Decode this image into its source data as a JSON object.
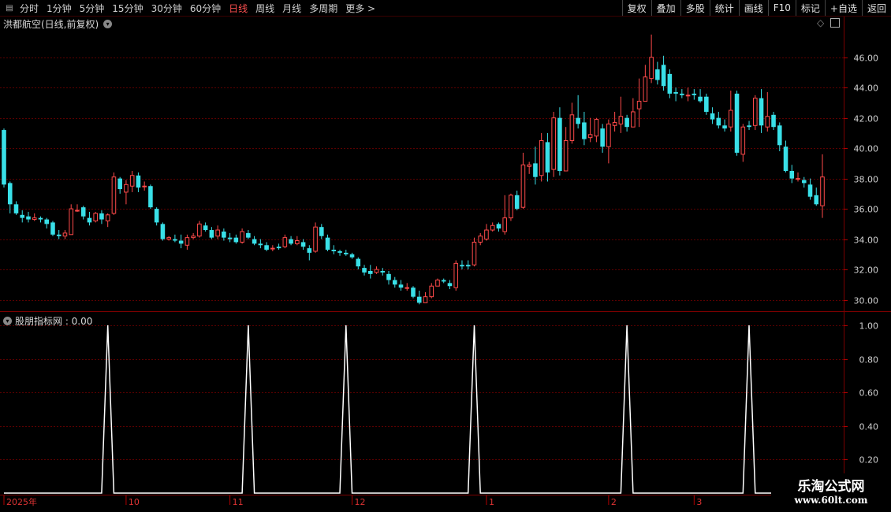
{
  "toolbar": {
    "periods": [
      {
        "label": "分时",
        "active": false
      },
      {
        "label": "1分钟",
        "active": false
      },
      {
        "label": "5分钟",
        "active": false
      },
      {
        "label": "15分钟",
        "active": false
      },
      {
        "label": "30分钟",
        "active": false
      },
      {
        "label": "60分钟",
        "active": false
      },
      {
        "label": "日线",
        "active": true
      },
      {
        "label": "周线",
        "active": false
      },
      {
        "label": "月线",
        "active": false
      },
      {
        "label": "多周期",
        "active": false
      },
      {
        "label": "更多 >",
        "active": false
      }
    ],
    "buttons": [
      "复权",
      "叠加",
      "多股",
      "统计",
      "画线",
      "F10",
      "标记",
      "+自选",
      "返回"
    ]
  },
  "main_panel": {
    "title": "洪都航空(日线,前复权)"
  },
  "indicator_panel": {
    "title": "股朋指标网 : 0.00"
  },
  "watermark": {
    "line1": "乐淘公式网",
    "line2": "www.60lt.com"
  },
  "colors": {
    "up": "#ff4a4a",
    "down": "#39e0e8",
    "grid": "#5a0000",
    "axis_text": "#d0d0d0",
    "background": "#000000",
    "line": "#ffffff"
  },
  "chart_data": [
    {
      "type": "candlestick",
      "title": "洪都航空(日线,前复权)",
      "y_axis": {
        "ticks": [
          30.0,
          32.0,
          34.0,
          36.0,
          38.0,
          40.0,
          42.0,
          44.0,
          46.0
        ],
        "ylim": [
          29.3,
          47.7
        ]
      },
      "x_axis": {
        "labels": [
          {
            "text": "2025年",
            "index": 0
          },
          {
            "text": "10",
            "index": 20
          },
          {
            "text": "11",
            "index": 37
          },
          {
            "text": "12",
            "index": 57
          },
          {
            "text": "1",
            "index": 79
          },
          {
            "text": "2",
            "index": 99
          },
          {
            "text": "3",
            "index": 113
          }
        ]
      },
      "candles": [
        [
          41.2,
          37.6,
          41.3,
          37.4
        ],
        [
          37.7,
          36.3,
          37.8,
          35.7
        ],
        [
          36.3,
          35.7,
          36.5,
          35.6
        ],
        [
          35.6,
          35.4,
          35.9,
          35.1
        ],
        [
          35.5,
          35.3,
          35.8,
          35.1
        ],
        [
          35.3,
          35.4,
          35.7,
          35.2
        ],
        [
          35.4,
          35.3,
          35.5,
          35.1
        ],
        [
          35.3,
          35.0,
          35.4,
          34.7
        ],
        [
          35.1,
          34.3,
          35.2,
          34.2
        ],
        [
          34.3,
          34.2,
          34.6,
          34.0
        ],
        [
          34.2,
          34.4,
          34.6,
          34.0
        ],
        [
          34.3,
          36.0,
          36.3,
          34.3
        ],
        [
          35.9,
          35.9,
          36.3,
          35.8
        ],
        [
          36.1,
          35.5,
          36.2,
          35.3
        ],
        [
          35.4,
          35.1,
          35.8,
          34.9
        ],
        [
          35.2,
          35.7,
          35.8,
          35.1
        ],
        [
          35.7,
          35.3,
          35.9,
          35.0
        ],
        [
          35.2,
          35.6,
          35.7,
          34.8
        ],
        [
          35.7,
          38.1,
          38.4,
          35.6
        ],
        [
          38.0,
          37.3,
          38.1,
          37.0
        ],
        [
          37.1,
          37.6,
          37.9,
          36.3
        ],
        [
          37.5,
          38.2,
          38.5,
          37.1
        ],
        [
          38.2,
          37.4,
          38.4,
          37.1
        ],
        [
          37.5,
          37.5,
          37.8,
          37.2
        ],
        [
          37.5,
          36.1,
          37.6,
          36.0
        ],
        [
          36.0,
          35.1,
          36.1,
          34.9
        ],
        [
          35.0,
          34.0,
          35.1,
          33.9
        ],
        [
          34.0,
          34.1,
          34.2,
          33.9
        ],
        [
          34.0,
          33.9,
          34.3,
          33.8
        ],
        [
          33.9,
          33.7,
          34.3,
          33.4
        ],
        [
          33.6,
          34.1,
          34.3,
          33.3
        ],
        [
          34.1,
          34.2,
          34.4,
          34.0
        ],
        [
          34.2,
          35.0,
          35.2,
          34.1
        ],
        [
          34.9,
          34.6,
          35.1,
          34.5
        ],
        [
          34.6,
          34.1,
          34.8,
          34.0
        ],
        [
          34.2,
          34.6,
          34.9,
          34.0
        ],
        [
          34.5,
          34.1,
          34.7,
          33.9
        ],
        [
          34.1,
          34.0,
          34.4,
          33.8
        ],
        [
          34.1,
          33.8,
          34.3,
          33.7
        ],
        [
          33.8,
          34.5,
          34.7,
          33.7
        ],
        [
          34.4,
          34.1,
          34.6,
          34.0
        ],
        [
          34.0,
          33.7,
          34.2,
          33.6
        ],
        [
          33.7,
          33.6,
          34.0,
          33.4
        ],
        [
          33.6,
          33.3,
          33.8,
          33.2
        ],
        [
          33.4,
          33.4,
          33.6,
          33.2
        ],
        [
          33.5,
          33.4,
          33.7,
          33.3
        ],
        [
          33.5,
          34.1,
          34.3,
          33.4
        ],
        [
          34.0,
          33.7,
          34.2,
          33.6
        ],
        [
          33.7,
          33.9,
          34.2,
          33.6
        ],
        [
          33.8,
          33.5,
          34.0,
          33.3
        ],
        [
          33.4,
          33.1,
          33.6,
          32.6
        ],
        [
          33.2,
          34.8,
          35.1,
          33.1
        ],
        [
          34.8,
          34.2,
          35.0,
          34.0
        ],
        [
          34.1,
          33.3,
          34.3,
          33.2
        ],
        [
          33.3,
          33.2,
          33.6,
          33.0
        ],
        [
          33.2,
          33.1,
          33.3,
          32.9
        ],
        [
          33.1,
          33.0,
          33.3,
          32.9
        ],
        [
          33.0,
          32.8,
          33.1,
          32.7
        ],
        [
          32.7,
          32.2,
          32.8,
          32.0
        ],
        [
          32.1,
          31.8,
          32.3,
          31.6
        ],
        [
          31.9,
          31.7,
          32.3,
          31.4
        ],
        [
          31.8,
          32.0,
          32.2,
          31.7
        ],
        [
          31.9,
          31.8,
          32.1,
          31.6
        ],
        [
          31.7,
          31.3,
          31.9,
          31.0
        ],
        [
          31.3,
          31.0,
          31.5,
          30.8
        ],
        [
          31.0,
          30.8,
          31.3,
          30.6
        ],
        [
          30.8,
          30.8,
          31.1,
          30.6
        ],
        [
          30.8,
          30.2,
          30.9,
          30.1
        ],
        [
          30.2,
          29.8,
          30.6,
          29.7
        ],
        [
          29.8,
          30.2,
          30.5,
          29.8
        ],
        [
          30.2,
          30.9,
          31.1,
          30.1
        ],
        [
          30.9,
          31.3,
          31.4,
          30.9
        ],
        [
          31.3,
          31.2,
          31.4,
          31.1
        ],
        [
          31.1,
          30.9,
          31.3,
          30.7
        ],
        [
          30.8,
          32.4,
          32.6,
          30.6
        ],
        [
          32.3,
          32.2,
          32.6,
          32.0
        ],
        [
          32.3,
          32.2,
          32.6,
          32.0
        ],
        [
          32.3,
          33.8,
          34.1,
          32.2
        ],
        [
          33.8,
          34.2,
          34.4,
          33.6
        ],
        [
          34.0,
          34.6,
          35.0,
          33.9
        ],
        [
          34.6,
          34.9,
          35.1,
          34.5
        ],
        [
          35.0,
          34.7,
          35.1,
          34.5
        ],
        [
          34.5,
          35.4,
          36.9,
          34.3
        ],
        [
          35.4,
          36.9,
          37.0,
          35.2
        ],
        [
          36.9,
          36.0,
          37.2,
          35.9
        ],
        [
          36.1,
          38.9,
          39.7,
          36.0
        ],
        [
          38.8,
          38.9,
          39.1,
          38.3
        ],
        [
          39.0,
          38.1,
          40.1,
          37.6
        ],
        [
          38.2,
          40.5,
          41.0,
          37.8
        ],
        [
          40.4,
          38.4,
          41.0,
          37.8
        ],
        [
          38.6,
          42.0,
          42.4,
          38.1
        ],
        [
          42.0,
          38.5,
          42.7,
          38.2
        ],
        [
          38.5,
          40.5,
          41.4,
          38.9
        ],
        [
          40.5,
          42.2,
          43.0,
          40.3
        ],
        [
          42.0,
          41.6,
          43.5,
          41.3
        ],
        [
          41.7,
          40.6,
          42.4,
          40.2
        ],
        [
          40.7,
          40.9,
          42.0,
          40.4
        ],
        [
          40.8,
          41.9,
          42.0,
          40.4
        ],
        [
          41.3,
          40.1,
          41.6,
          39.7
        ],
        [
          40.1,
          41.6,
          41.9,
          39.0
        ],
        [
          41.5,
          41.7,
          42.4,
          41.1
        ],
        [
          41.6,
          42.1,
          43.4,
          41.0
        ],
        [
          42.0,
          41.4,
          42.2,
          41.1
        ],
        [
          41.4,
          42.4,
          43.3,
          41.5
        ],
        [
          42.6,
          43.1,
          44.6,
          41.4
        ],
        [
          43.1,
          44.7,
          45.5,
          43.1
        ],
        [
          44.6,
          46.0,
          47.5,
          44.3
        ],
        [
          45.2,
          44.5,
          45.7,
          44.2
        ],
        [
          45.5,
          44.1,
          46.1,
          43.8
        ],
        [
          44.9,
          43.6,
          45.2,
          43.3
        ],
        [
          43.7,
          43.6,
          44.0,
          43.1
        ],
        [
          43.6,
          43.5,
          43.9,
          43.3
        ],
        [
          43.5,
          43.5,
          44.0,
          43.1
        ],
        [
          43.6,
          43.5,
          43.9,
          43.2
        ],
        [
          43.4,
          43.1,
          43.9,
          43.0
        ],
        [
          43.4,
          42.4,
          43.6,
          42.2
        ],
        [
          42.3,
          41.9,
          42.7,
          41.6
        ],
        [
          42.0,
          41.5,
          42.4,
          41.3
        ],
        [
          41.5,
          41.3,
          41.9,
          41.1
        ],
        [
          41.4,
          42.5,
          43.8,
          41.1
        ],
        [
          43.6,
          39.7,
          43.8,
          39.5
        ],
        [
          39.6,
          41.4,
          41.6,
          39.1
        ],
        [
          41.5,
          41.4,
          41.8,
          41.2
        ],
        [
          41.5,
          43.3,
          43.5,
          41.2
        ],
        [
          43.3,
          41.5,
          43.9,
          41.0
        ],
        [
          41.4,
          42.1,
          43.7,
          41.1
        ],
        [
          42.2,
          41.4,
          42.4,
          41.2
        ],
        [
          41.5,
          40.2,
          41.7,
          39.8
        ],
        [
          40.1,
          38.5,
          40.5,
          38.4
        ],
        [
          38.5,
          38.0,
          38.9,
          37.7
        ],
        [
          38.0,
          38.0,
          38.4,
          37.8
        ],
        [
          37.9,
          37.7,
          38.1,
          37.4
        ],
        [
          37.6,
          36.8,
          38.0,
          36.6
        ],
        [
          36.9,
          36.3,
          37.4,
          36.2
        ],
        [
          36.2,
          38.1,
          39.6,
          35.4
        ]
      ]
    },
    {
      "type": "line",
      "title": "股朋指标网",
      "y_axis": {
        "ticks": [
          0.2,
          0.4,
          0.6,
          0.8,
          1.0
        ],
        "ylim": [
          0,
          1.07
        ]
      },
      "peak_indices": [
        17,
        40,
        56,
        77,
        102,
        122
      ],
      "baseline": 0.0,
      "peak": 1.0,
      "points": 129
    }
  ]
}
